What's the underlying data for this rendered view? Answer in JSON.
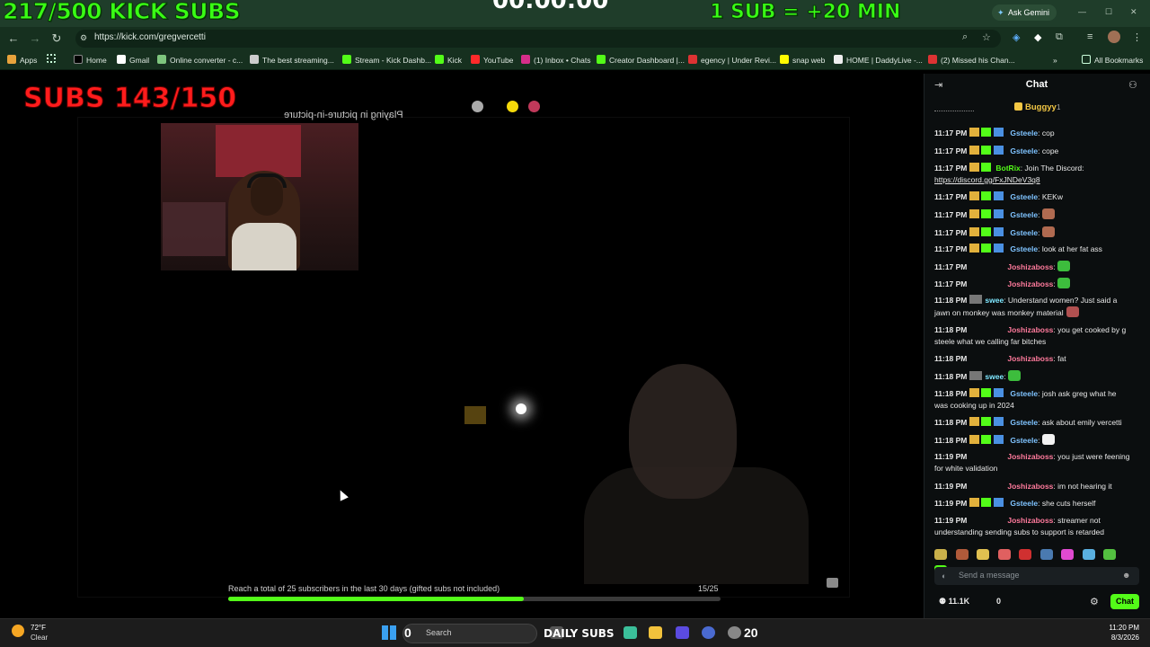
{
  "browser": {
    "url": "https://kick.com/gregvercetti",
    "apps_label": "Apps",
    "bookmarks": [
      "Home",
      "Gmail",
      "Online converter - c...",
      "The best streaming...",
      "Stream - Kick Dashb...",
      "Kick",
      "YouTube",
      "(1) Inbox • Chats",
      "Creator Dashboard |...",
      "egency | Under Revi...",
      "snap web",
      "HOME | DaddyLive -...",
      "(2) Missed his Chan..."
    ],
    "all_bookmarks": "All Bookmarks",
    "ask_gemini": "Ask Gemini"
  },
  "overlay": {
    "kick_subs": "217/500 KICK SUBS",
    "timer": "00:00:00",
    "sub_rule": "1 SUB = +20 MIN",
    "subs_red": "SUBS 143/150",
    "pip_text": "Playing in picture-in-picture"
  },
  "goal": {
    "text": "Reach a total of 25 subscribers in the last 30 days (gifted subs not included)",
    "count": "15/25",
    "progress": 0.6
  },
  "chat": {
    "title": "Chat",
    "pinned_user": "Buggyy",
    "pinned_count": "1",
    "messages": [
      {
        "time": "11:17 PM",
        "user": "Gsteele",
        "text": "cop"
      },
      {
        "time": "11:17 PM",
        "user": "Gsteele",
        "text": "cope"
      },
      {
        "time": "11:17 PM",
        "user": "BotRix",
        "text": "Join The Discord:",
        "link": "https://discord.gg/FxJNDeV3q8"
      },
      {
        "time": "11:17 PM",
        "user": "Gsteele",
        "text": "KEKw"
      },
      {
        "time": "11:17 PM",
        "user": "Gsteele",
        "text": ""
      },
      {
        "time": "11:17 PM",
        "user": "Gsteele",
        "text": ""
      },
      {
        "time": "11:17 PM",
        "user": "Gsteele",
        "text": "look at her fat ass"
      },
      {
        "time": "11:17 PM",
        "user": "Joshizaboss",
        "text": ""
      },
      {
        "time": "11:17 PM",
        "user": "Joshizaboss",
        "text": ""
      },
      {
        "time": "11:18 PM",
        "user": "swee",
        "text": "Understand women? Just said a jawn on monkey was monkey material"
      },
      {
        "time": "11:18 PM",
        "user": "Joshizaboss",
        "text": "you get cooked by g steele what we calling far bitches"
      },
      {
        "time": "11:18 PM",
        "user": "Joshizaboss",
        "text": "fat"
      },
      {
        "time": "11:18 PM",
        "user": "swee",
        "text": ""
      },
      {
        "time": "11:18 PM",
        "user": "Gsteele",
        "text": "josh ask greg what he was cooking up in 2024"
      },
      {
        "time": "11:18 PM",
        "user": "Gsteele",
        "text": "ask about emily vercetti"
      },
      {
        "time": "11:18 PM",
        "user": "Gsteele",
        "text": ""
      },
      {
        "time": "11:19 PM",
        "user": "Joshizaboss",
        "text": "you just were feening for white validation"
      },
      {
        "time": "11:19 PM",
        "user": "Joshizaboss",
        "text": "im not hearing it"
      },
      {
        "time": "11:19 PM",
        "user": "Gsteele",
        "text": "she cuts herself"
      },
      {
        "time": "11:19 PM",
        "user": "Joshizaboss",
        "text": "streamer not understanding sending subs to support is retarded"
      }
    ],
    "input_placeholder": "Send a message",
    "viewers": "11.1K",
    "zero": "0",
    "chat_button": "Chat"
  },
  "taskbar": {
    "temperature": "72°F",
    "condition": "Clear",
    "search": "Search",
    "left_count": "0",
    "daily_subs": "DAILY SUBS",
    "daily_count": "20",
    "time": "11:20 PM",
    "date": "8/3/2026"
  },
  "colors": {
    "kick_green": "#53fc18",
    "overlay_green": "#39ff14",
    "overlay_red": "#ff1c1c",
    "chrome_green": "#1f3d2a"
  }
}
